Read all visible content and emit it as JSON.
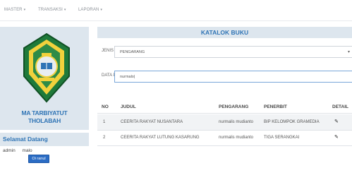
{
  "nav": [
    {
      "label": "MASTER"
    },
    {
      "label": "TRANSAKSI"
    },
    {
      "label": "LAPORAN"
    }
  ],
  "sidebar": {
    "school_name_line1": "MA TARBIYATUT",
    "school_name_line2": "THOLABAH",
    "welcome": "Selamat Datang",
    "user_role": "admin",
    "user_name": "malo",
    "logout_label": "Oi ranul"
  },
  "content": {
    "title": "KATALOK BUKU",
    "search_type_label": "JENIS PENCARIAN",
    "search_type_value": "PENGARANG",
    "search_data_label": "DATA PENCARIAN",
    "search_data_value": "nurmalo|"
  },
  "table": {
    "headers": [
      "NO",
      "JUDUL",
      "PENGARANG",
      "PENERBIT",
      "DETAIL"
    ],
    "rows": [
      {
        "no": "1",
        "judul": "CEERITA RAKYAT NUSANTARA",
        "pengarang": "nurmalis mudianto",
        "penerbit": "BIP KELOMPOK GRAMEDIA"
      },
      {
        "no": "2",
        "judul": "CEERITA RAKYAT LUTUNG KASARUNG",
        "pengarang": "nurmalis mudianto",
        "penerbit": "TIGA SERANGKAI"
      }
    ]
  },
  "colors": {
    "accent": "#2f74b5",
    "panel": "#dde6ee",
    "button": "#2b6cc4",
    "logo_green": "#1f7a3a",
    "logo_yellow": "#f2d13c"
  },
  "icons": {
    "dropdown": "chevron-down-icon",
    "detail": "pencil-icon"
  }
}
